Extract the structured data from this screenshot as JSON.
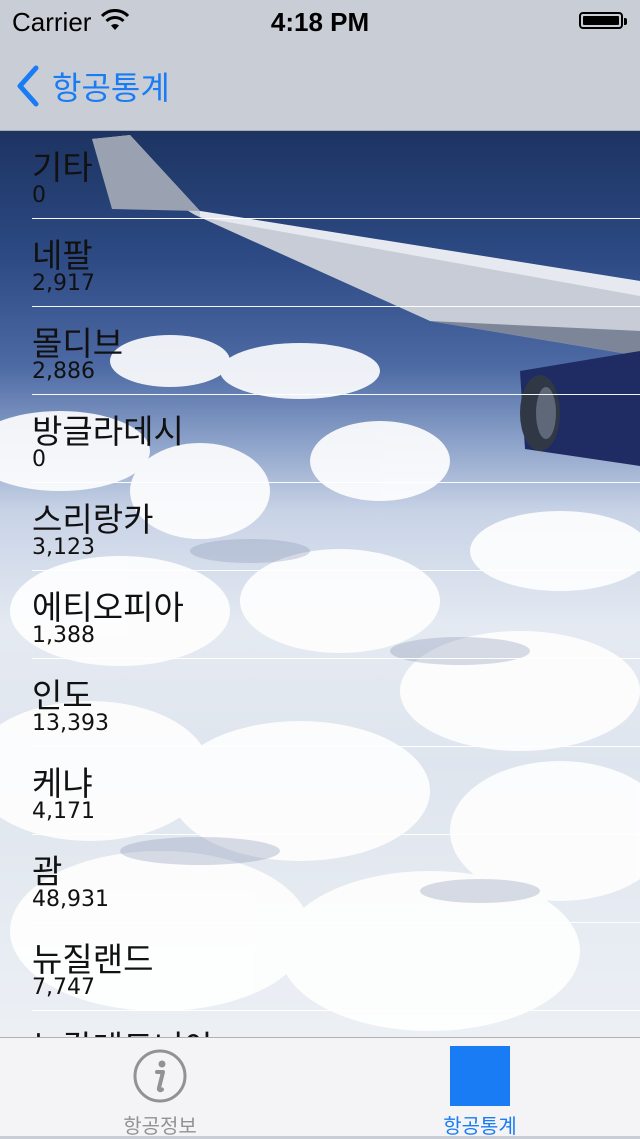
{
  "status_bar": {
    "carrier": "Carrier",
    "time": "4:18 PM"
  },
  "nav": {
    "back_label": "항공통계"
  },
  "list": [
    {
      "name": "기타",
      "value": "0"
    },
    {
      "name": "네팔",
      "value": "2,917"
    },
    {
      "name": "몰디브",
      "value": "2,886"
    },
    {
      "name": "방글라데시",
      "value": "0"
    },
    {
      "name": "스리랑카",
      "value": "3,123"
    },
    {
      "name": "에티오피아",
      "value": "1,388"
    },
    {
      "name": "인도",
      "value": "13,393"
    },
    {
      "name": "케냐",
      "value": "4,171"
    },
    {
      "name": "괌",
      "value": "48,931"
    },
    {
      "name": "뉴질랜드",
      "value": "7,747"
    },
    {
      "name": "뉴칼레도니아",
      "value": ""
    }
  ],
  "tabs": [
    {
      "label": "항공정보",
      "icon": "info-icon",
      "selected": false
    },
    {
      "label": "항공통계",
      "icon": "square-icon",
      "selected": true
    }
  ],
  "colors": {
    "accent": "#1a7cf5",
    "bar_bg": "#c9cdd6",
    "tab_inactive": "#929292"
  }
}
